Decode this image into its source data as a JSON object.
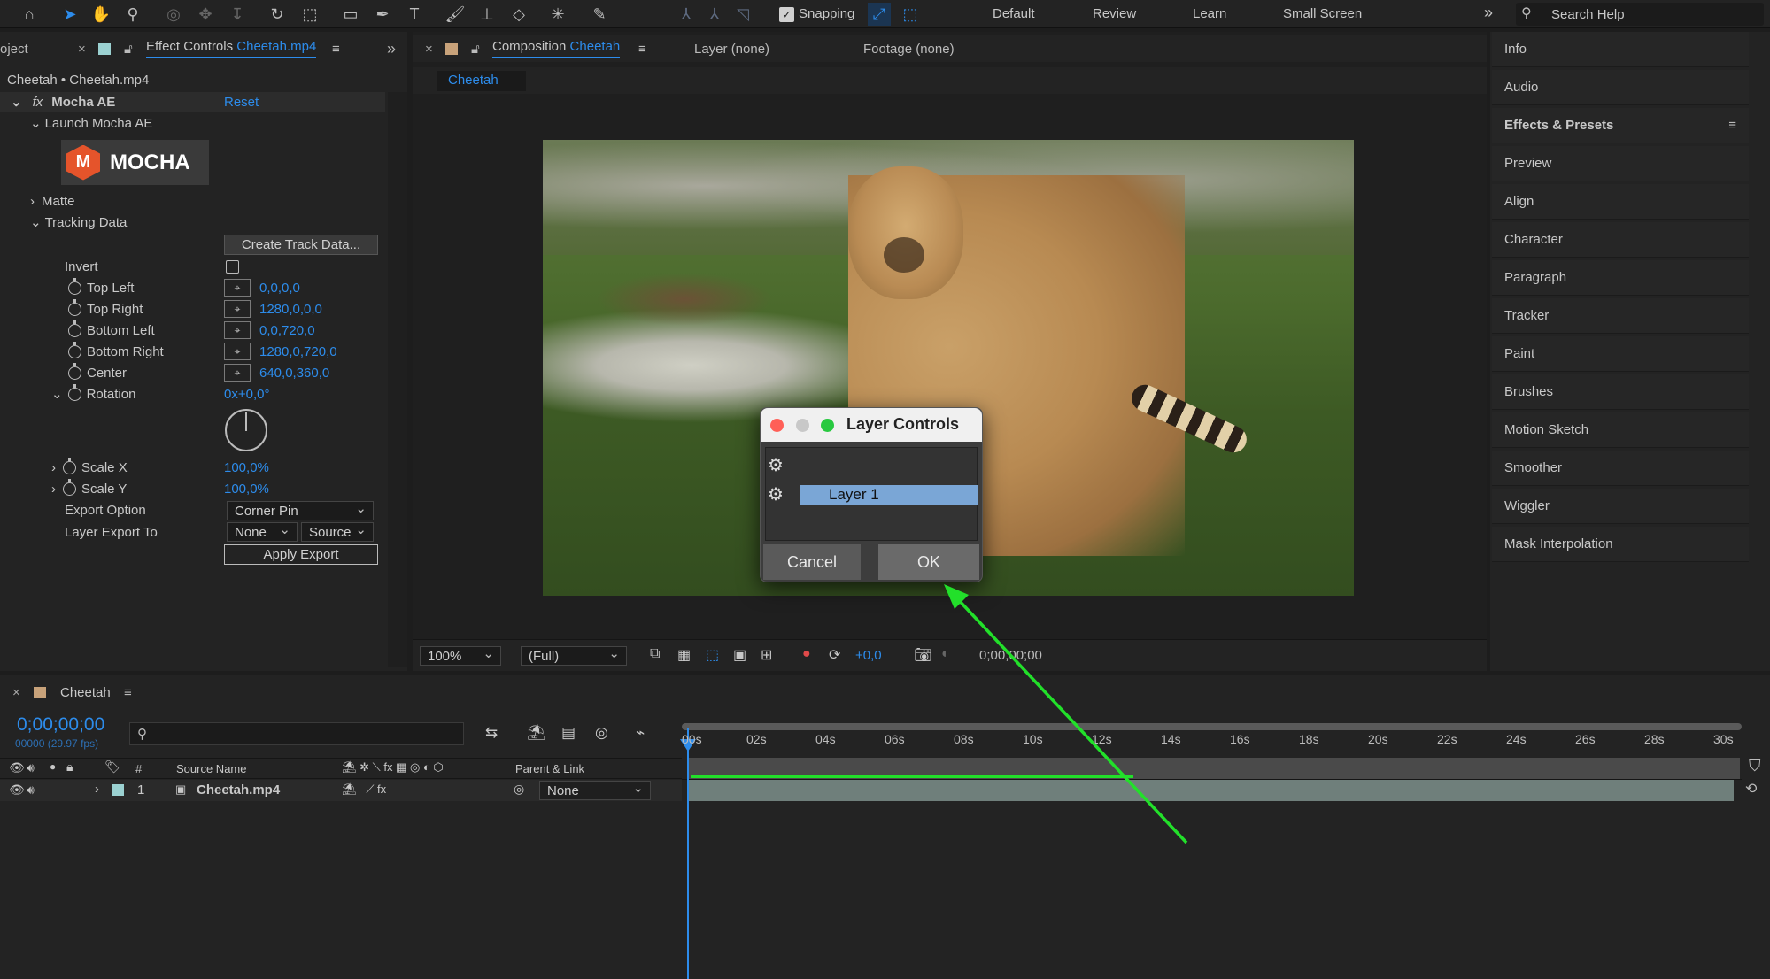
{
  "toolbar": {
    "snapping_label": "Snapping",
    "workspaces": [
      "Default",
      "Review",
      "Learn",
      "Small Screen"
    ],
    "search_placeholder": "Search Help"
  },
  "left_panel": {
    "project_tab": "oject",
    "effect_controls_tab": "Effect Controls",
    "effect_controls_file": "Cheetah.mp4",
    "breadcrumb": "Cheetah • Cheetah.mp4",
    "effect_name": "Mocha AE",
    "reset_label": "Reset",
    "launch_label": "Launch Mocha AE",
    "mocha_logo_text": "MOCHA",
    "matte_label": "Matte",
    "tracking_data_label": "Tracking Data",
    "create_track_button": "Create Track Data...",
    "invert_label": "Invert",
    "params": [
      {
        "label": "Top Left",
        "value": "0,0,0,0"
      },
      {
        "label": "Top Right",
        "value": "1280,0,0,0"
      },
      {
        "label": "Bottom Left",
        "value": "0,0,720,0"
      },
      {
        "label": "Bottom Right",
        "value": "1280,0,720,0"
      },
      {
        "label": "Center",
        "value": "640,0,360,0"
      }
    ],
    "rotation_label": "Rotation",
    "rotation_value": "0x+0,0°",
    "scale_x_label": "Scale X",
    "scale_x_value": "100,0%",
    "scale_y_label": "Scale Y",
    "scale_y_value": "100,0%",
    "export_option_label": "Export Option",
    "export_option_value": "Corner Pin",
    "layer_export_label": "Layer Export To",
    "layer_export_value": "None",
    "source_value": "Source",
    "apply_export_button": "Apply Export"
  },
  "composition": {
    "tab_label": "Composition",
    "tab_name": "Cheetah",
    "layer_tab": "Layer (none)",
    "footage_tab": "Footage (none)",
    "sub_tab": "Cheetah",
    "zoom": "100%",
    "resolution": "(Full)",
    "exposure": "+0,0",
    "timecode": "0;00;00;00"
  },
  "dialog": {
    "title": "Layer Controls",
    "layer_item": "Layer 1",
    "cancel_label": "Cancel",
    "ok_label": "OK"
  },
  "right_panel": {
    "items": [
      "Info",
      "Audio",
      "Effects & Presets",
      "Preview",
      "Align",
      "Character",
      "Paragraph",
      "Tracker",
      "Paint",
      "Brushes",
      "Motion Sketch",
      "Smoother",
      "Wiggler",
      "Mask Interpolation"
    ]
  },
  "timeline": {
    "tab_name": "Cheetah",
    "timecode": "0;00;00;00",
    "frame_info": "00000 (29.97 fps)",
    "col_source_name": "Source Name",
    "col_hash": "#",
    "col_parent": "Parent & Link",
    "layer_number": "1",
    "layer_name": "Cheetah.mp4",
    "parent_value": "None",
    "ruler_labels": [
      "00s",
      "02s",
      "04s",
      "06s",
      "08s",
      "10s",
      "12s",
      "14s",
      "16s",
      "18s",
      "20s",
      "22s",
      "24s",
      "26s",
      "28s",
      "30s"
    ]
  },
  "colors": {
    "accent": "#2d8ceb",
    "arrow": "#22e02a",
    "dialog_selection": "#7aa6d6"
  }
}
